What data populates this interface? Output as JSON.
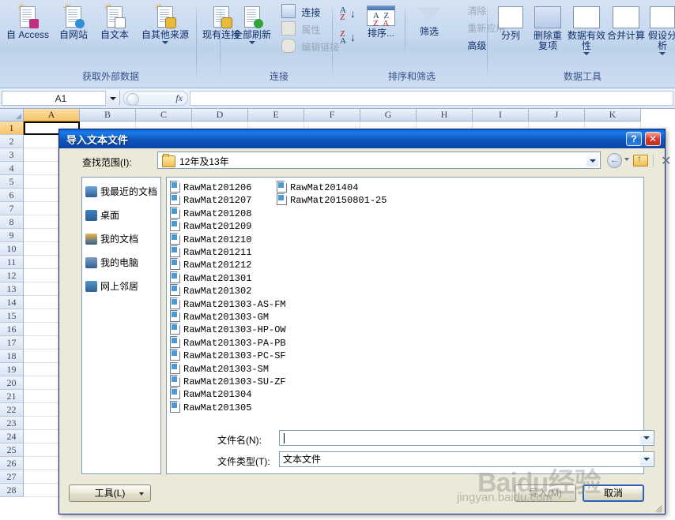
{
  "ribbon": {
    "groups": [
      {
        "name": "获取外部数据",
        "buttons": [
          "自 Access",
          "自网站",
          "自文本",
          "自其他来源",
          "现有连接"
        ]
      },
      {
        "name": "连接",
        "big": "全部刷新",
        "small": [
          "连接",
          "属性",
          "编辑链接"
        ]
      },
      {
        "name": "排序和筛选",
        "big": [
          "排序...",
          "筛选"
        ],
        "small": [
          "清除",
          "重新应用",
          "高级"
        ]
      },
      {
        "name": "数据工具",
        "buttons": [
          "分列",
          "删除重复项",
          "数据有效性",
          "合并计算",
          "假设分析"
        ]
      }
    ]
  },
  "formula_bar": {
    "name_box": "A1",
    "fx_label": "fx",
    "formula_value": ""
  },
  "sheet": {
    "columns": [
      "A",
      "B",
      "C",
      "D",
      "E",
      "F",
      "G",
      "H",
      "I",
      "J",
      "K"
    ],
    "selected_column": "A",
    "rows": [
      1,
      2,
      3,
      4,
      5,
      6,
      7,
      8,
      9,
      10,
      11,
      12,
      13,
      14,
      15,
      16,
      17,
      18,
      19,
      20,
      21,
      22,
      23,
      24,
      25,
      26,
      27,
      28
    ],
    "selected_row": 1,
    "active_cell": "A1"
  },
  "dialog": {
    "title": "导入文本文件",
    "help_label": "?",
    "close_label": "✕",
    "lookin_label": "查找范围(I):",
    "lookin_value": "12年及13年",
    "toolbar": [
      "back-icon",
      "up-one-level-icon",
      "delete-icon",
      "new-folder-icon",
      "views-icon"
    ],
    "places": [
      "我最近的文档",
      "桌面",
      "我的文档",
      "我的电脑",
      "网上邻居"
    ],
    "files_col1": [
      "RawMat201206",
      "RawMat201207",
      "RawMat201208",
      "RawMat201209",
      "RawMat201210",
      "RawMat201211",
      "RawMat201212",
      "RawMat201301",
      "RawMat201302",
      "RawMat201303-AS-FM",
      "RawMat201303-GM",
      "RawMat201303-HP-OW",
      "RawMat201303-PA-PB",
      "RawMat201303-PC-SF",
      "RawMat201303-SM",
      "RawMat201303-SU-ZF",
      "RawMat201304",
      "RawMat201305"
    ],
    "files_col2": [
      "RawMat201404",
      "RawMat20150801-25"
    ],
    "filename_label": "文件名(N):",
    "filename_value": "",
    "filetype_label": "文件类型(T):",
    "filetype_value": "文本文件",
    "tools_button": "工具(L)",
    "import_button": "导入(M)",
    "cancel_button": "取消"
  },
  "watermark": {
    "big": "Baidu经验",
    "small": "jingyan.baidu.com"
  }
}
